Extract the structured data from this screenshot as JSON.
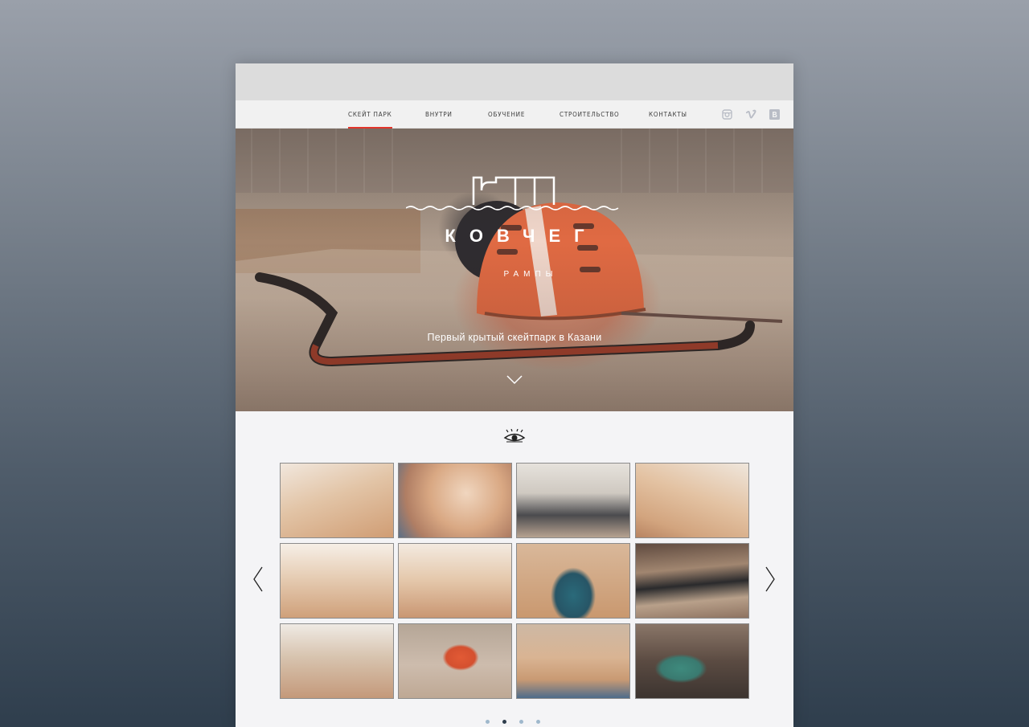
{
  "nav": {
    "items": [
      {
        "label": "СКЕЙТ ПАРК",
        "active": true
      },
      {
        "label": "ВНУТРИ",
        "active": false
      },
      {
        "label": "ОБУЧЕНИЕ",
        "active": false
      },
      {
        "label": "СТРОИТЕЛЬСТВО",
        "active": false
      },
      {
        "label": "КОНТАКТЫ",
        "active": false
      }
    ],
    "social_icons": [
      "instagram-icon",
      "vimeo-icon",
      "vk-icon"
    ]
  },
  "hero": {
    "logo_title": "КОВЧЕГ",
    "logo_subtitle": "РАМПЫ",
    "tagline": "Первый крытый скейтпарк в Казани",
    "scroll_icon": "chevron-down-icon"
  },
  "gallery": {
    "section_icon": "eye-icon",
    "prev_icon": "chevron-left-icon",
    "next_icon": "chevron-right-icon",
    "pages": 4,
    "active_page": 2
  },
  "colors": {
    "accent": "#e2342a",
    "nav_text": "#3c3c3c",
    "social_icon": "#b9bdc6",
    "dot_inactive": "#9fb8cc",
    "dot_active": "#2f3e4d"
  }
}
